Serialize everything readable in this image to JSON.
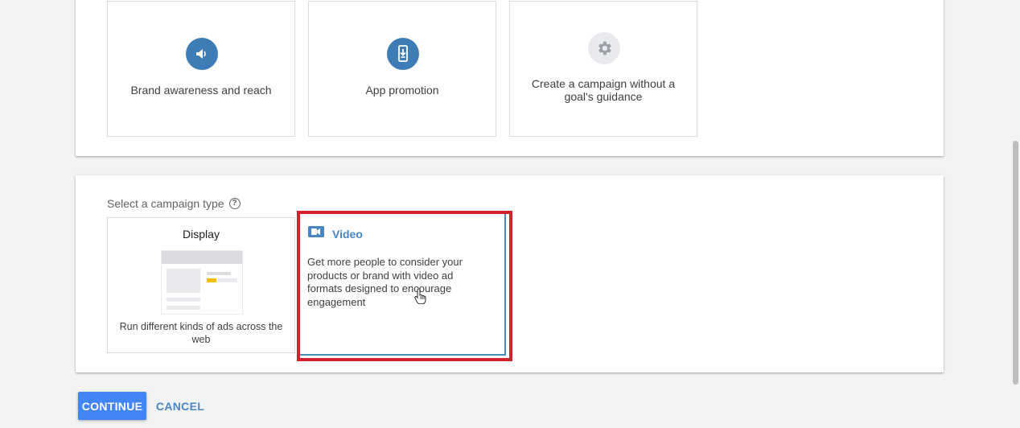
{
  "goal_cards": [
    {
      "label": "Brand awareness and reach",
      "icon": "megaphone-icon",
      "icon_bg": "#3e7cb5"
    },
    {
      "label": "App promotion",
      "icon": "phone-download-icon",
      "icon_bg": "#3e7cb5"
    },
    {
      "label": "Create a campaign without a goal's guidance",
      "icon": "gear-icon",
      "icon_bg": "#e8eaed"
    }
  ],
  "campaign_type": {
    "heading": "Select a campaign type",
    "options": [
      {
        "title": "Display",
        "description": "Run different kinds of ads across the web"
      },
      {
        "title": "Video",
        "description": "Get more people to consider your products or brand with video ad formats designed to encourage engagement",
        "selected": true
      }
    ]
  },
  "actions": {
    "continue_label": "CONTINUE",
    "cancel_label": "CANCEL"
  },
  "colors": {
    "accent": "#4285f4",
    "link": "#4a86c5",
    "highlight": "#d3202d"
  }
}
